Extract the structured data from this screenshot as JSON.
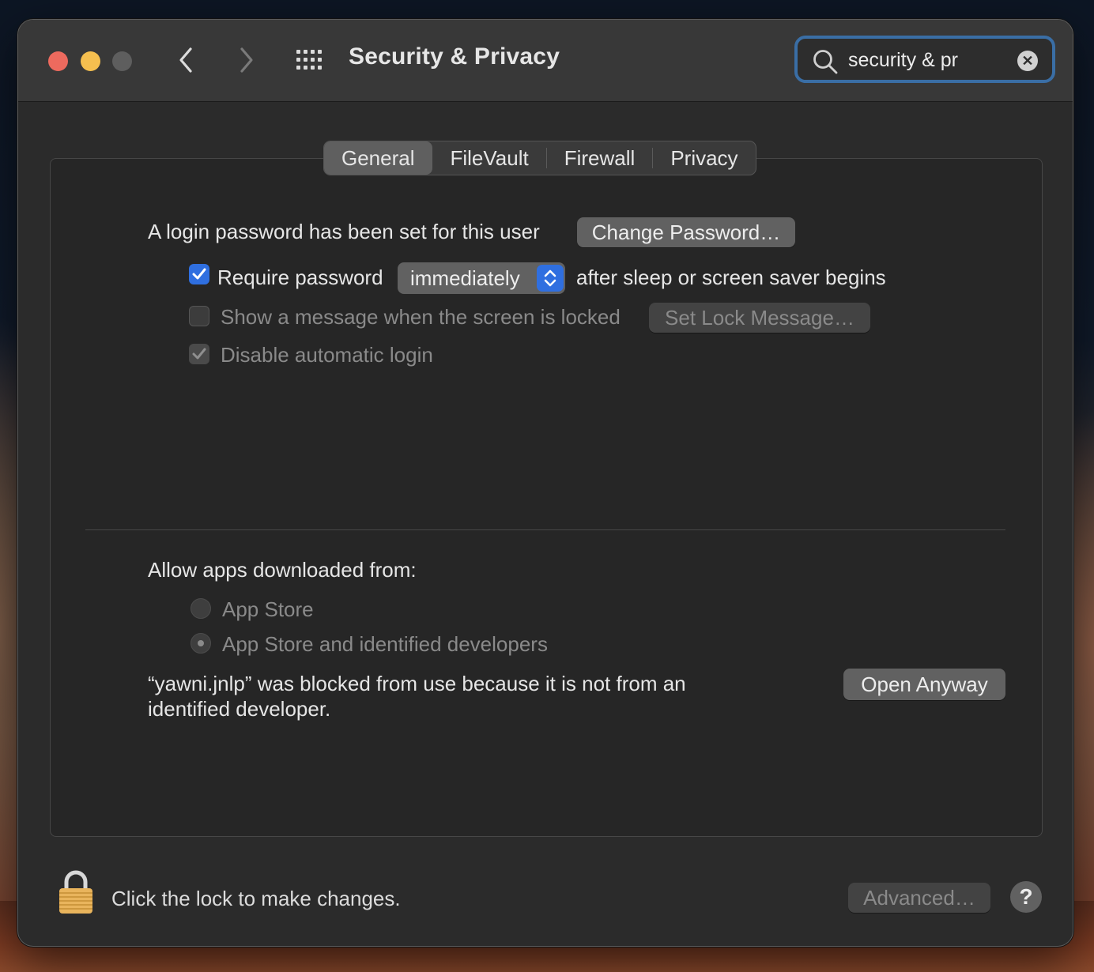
{
  "window": {
    "title": "Security & Privacy",
    "search": {
      "value": "security & pr"
    }
  },
  "tabs": [
    {
      "label": "General",
      "active": true
    },
    {
      "label": "FileVault",
      "active": false
    },
    {
      "label": "Firewall",
      "active": false
    },
    {
      "label": "Privacy",
      "active": false
    }
  ],
  "general": {
    "login_password_text": "A login password has been set for this user",
    "change_password_label": "Change Password…",
    "require_password": {
      "checked": true,
      "label": "Require password",
      "selected": "immediately",
      "suffix": "after sleep or screen saver begins"
    },
    "show_message": {
      "checked": false,
      "label": "Show a message when the screen is locked",
      "button_label": "Set Lock Message…"
    },
    "disable_auto_login": {
      "checked": true,
      "label": "Disable automatic login"
    }
  },
  "allow_apps": {
    "heading": "Allow apps downloaded from:",
    "options": [
      {
        "label": "App Store",
        "selected": false
      },
      {
        "label": "App Store and identified developers",
        "selected": true
      }
    ],
    "blocked_line1": "“yawni.jnlp” was blocked from use because it is not from an",
    "blocked_line2": "identified developer.",
    "open_anyway_label": "Open Anyway"
  },
  "footer": {
    "lock_text": "Click the lock to make changes.",
    "advanced_label": "Advanced…",
    "help_label": "?"
  },
  "colors": {
    "accent": "#2f6fe0",
    "close": "#ed6a5e",
    "minimize": "#f5bf4f",
    "search_focus": "#3a6ea5"
  }
}
